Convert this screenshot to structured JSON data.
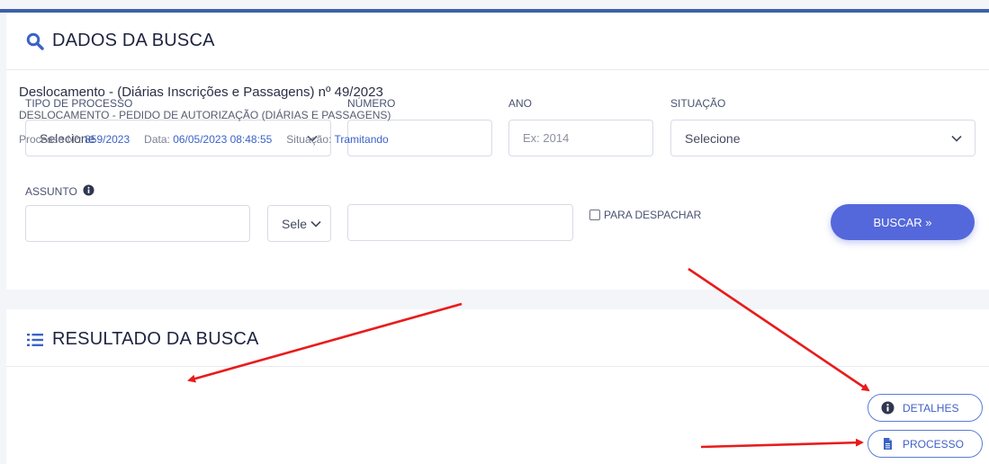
{
  "search": {
    "title": "DADOS DA BUSCA",
    "title_icon": "search-icon",
    "tipo_label": "TIPO DE PROCESSO",
    "tipo_value": "Selecione",
    "numero_label": "NÚMERO",
    "numero_value": "",
    "ano_label": "ANO",
    "ano_placeholder": "Ex: 2014",
    "situacao_label": "SITUAÇÃO",
    "situacao_value": "Selecione",
    "assunto_label": "ASSUNTO",
    "assunto_value": "",
    "assunto_select_value": "Sele",
    "assunto_text_value": "",
    "para_despachar_label": "PARA DESPACHAR",
    "buscar_label": "BUSCAR »"
  },
  "results": {
    "title": "RESULTADO DA BUSCA",
    "title_icon": "list-icon",
    "item": {
      "title": "Deslocamento - (Diárias Inscrições e Passagens) nº 49/2023",
      "subtitle": "DESLOCAMENTO - PEDIDO DE AUTORIZAÇÃO (DIÁRIAS E PASSAGENS)",
      "processo_label": "Processo Nº:",
      "processo_value": "859/2023",
      "data_label": "Data:",
      "data_value": "06/05/2023 08:48:55",
      "situacao_label": "Situação:",
      "situacao_value": "Tramitando",
      "detalhes_label": "DETALHES",
      "processo_button_label": "PROCESSO"
    }
  },
  "colors": {
    "accent": "#5468db",
    "top_bar": "#3b62a8",
    "link": "#3b62c7",
    "annotation_arrow": "#e81c1c"
  }
}
